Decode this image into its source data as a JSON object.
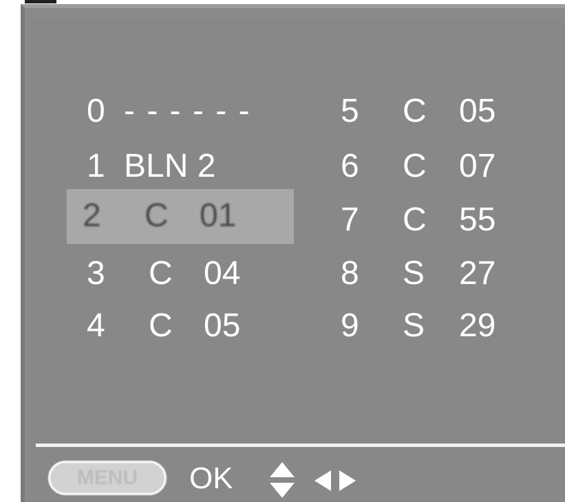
{
  "channels": {
    "left": [
      {
        "num": "0",
        "type": "",
        "name": "- - - - - -"
      },
      {
        "num": "1",
        "type": "",
        "name": "BLN 2"
      },
      {
        "num": "2",
        "type": "C",
        "name": "01"
      },
      {
        "num": "3",
        "type": "C",
        "name": "04"
      },
      {
        "num": "4",
        "type": "C",
        "name": "05"
      }
    ],
    "right": [
      {
        "num": "5",
        "type": "C",
        "name": "05"
      },
      {
        "num": "6",
        "type": "C",
        "name": "07"
      },
      {
        "num": "7",
        "type": "C",
        "name": "55"
      },
      {
        "num": "8",
        "type": "S",
        "name": "27"
      },
      {
        "num": "9",
        "type": "S",
        "name": "29"
      }
    ],
    "selected_index": 2
  },
  "footer": {
    "menu_label": "MENU",
    "ok_label": "OK",
    "updown_icon": "up-down-arrows-icon",
    "leftright_icon": "left-right-arrows-icon"
  },
  "colors": {
    "background": "#888888",
    "text": "#ffffff",
    "selection": "#a8a8a8"
  }
}
